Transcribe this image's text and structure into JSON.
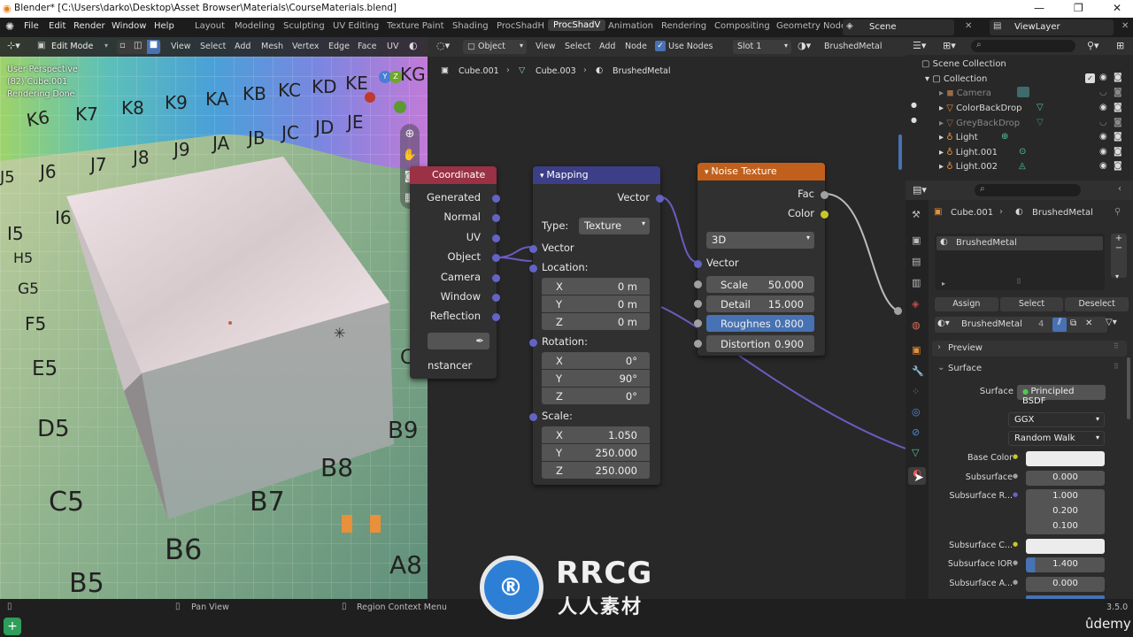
{
  "titlebar": {
    "title": "Blender* [C:\\Users\\darko\\Desktop\\Asset Browser\\Materials\\CourseMaterials.blend]"
  },
  "menu": [
    "File",
    "Edit",
    "Render",
    "Window",
    "Help"
  ],
  "workspaces": [
    "Layout",
    "Modeling",
    "Sculpting",
    "UV Editing",
    "Texture Paint",
    "Shading",
    "ProcShadH",
    "ProcShadV",
    "Animation",
    "Rendering",
    "Compositing",
    "Geometry Node"
  ],
  "scene": "Scene",
  "viewlayer": "ViewLayer",
  "viewport": {
    "mode": "Edit Mode",
    "menus": [
      "View",
      "Select",
      "Add",
      "Mesh",
      "Vertex",
      "Edge",
      "Face",
      "UV"
    ],
    "overlay_line1": "User Perspective",
    "overlay_line2": "(82) Cube.001",
    "overlay_line3": "Rendering Done",
    "grid_labels": [
      "K6",
      "K7",
      "K8",
      "K9",
      "KA",
      "KB",
      "KC",
      "KD",
      "KE",
      "KG",
      "J6",
      "J7",
      "J8",
      "J9",
      "JA",
      "JB",
      "JC",
      "JD",
      "JE",
      "I5",
      "I6",
      "H5",
      "G5",
      "F5",
      "E5",
      "D5",
      "C5",
      "B5",
      "B6",
      "B7",
      "B8",
      "B9",
      "A8",
      "CA",
      "J5"
    ]
  },
  "node_editor": {
    "object_dropdown": "Object",
    "menus": [
      "View",
      "Select",
      "Add",
      "Node"
    ],
    "use_nodes": "Use Nodes",
    "slot": "Slot 1",
    "material": "BrushedMetal",
    "breadcrumb": [
      "Cube.001",
      "Cube.003",
      "BrushedMetal"
    ],
    "tex_coord": {
      "title": "Coordinate",
      "outputs": [
        "Generated",
        "Normal",
        "UV",
        "Object",
        "Camera",
        "Window",
        "Reflection"
      ],
      "instancer": "nstancer"
    },
    "mapping": {
      "title": "Mapping",
      "vector_out": "Vector",
      "type_label": "Type:",
      "type_value": "Texture",
      "vector_in": "Vector",
      "location_label": "Location:",
      "location": [
        {
          "axis": "X",
          "value": "0 m"
        },
        {
          "axis": "Y",
          "value": "0 m"
        },
        {
          "axis": "Z",
          "value": "0 m"
        }
      ],
      "rotation_label": "Rotation:",
      "rotation": [
        {
          "axis": "X",
          "value": "0°"
        },
        {
          "axis": "Y",
          "value": "90°"
        },
        {
          "axis": "Z",
          "value": "0°"
        }
      ],
      "scale_label": "Scale:",
      "scale": [
        {
          "axis": "X",
          "value": "1.050"
        },
        {
          "axis": "Y",
          "value": "250.000"
        },
        {
          "axis": "Z",
          "value": "250.000"
        }
      ]
    },
    "noise": {
      "title": "Noise Texture",
      "fac": "Fac",
      "color": "Color",
      "dim": "3D",
      "vector": "Vector",
      "params": [
        {
          "label": "Scale",
          "value": "50.000"
        },
        {
          "label": "Detail",
          "value": "15.000"
        },
        {
          "label": "Roughnes",
          "value": "0.800"
        },
        {
          "label": "Distortion",
          "value": "0.900"
        }
      ]
    }
  },
  "outliner": {
    "root": "Scene Collection",
    "collection": "Collection",
    "items": [
      "Camera",
      "ColorBackDrop",
      "GreyBackDrop",
      "Light",
      "Light.001",
      "Light.002"
    ]
  },
  "properties": {
    "breadcrumb_obj": "Cube.001",
    "breadcrumb_mat": "BrushedMetal",
    "slot_name": "BrushedMetal",
    "assign": "Assign",
    "select": "Select",
    "deselect": "Deselect",
    "material_name": "BrushedMetal",
    "users": "4",
    "preview": "Preview",
    "surface_panel": "Surface",
    "surface_label": "Surface",
    "surface_value": "Principled BSDF",
    "distribution": "GGX",
    "subsurface_method": "Random Walk",
    "rows": [
      {
        "label": "Base Color",
        "value": ""
      },
      {
        "label": "Subsurface",
        "value": "0.000"
      },
      {
        "label": "Subsurface R...",
        "value": "1.000"
      },
      {
        "label": "",
        "value": "0.200"
      },
      {
        "label": "",
        "value": "0.100"
      },
      {
        "label": "Subsurface C...",
        "value": ""
      },
      {
        "label": "Subsurface IOR",
        "value": "1.400"
      },
      {
        "label": "Subsurface A...",
        "value": "0.000"
      }
    ]
  },
  "status": {
    "pan": "Pan View",
    "context": "Region Context Menu",
    "version": "3.5.0",
    "udemy": "ûdemy"
  },
  "watermark": {
    "logo": "RRCG",
    "sub": "人人素材"
  }
}
